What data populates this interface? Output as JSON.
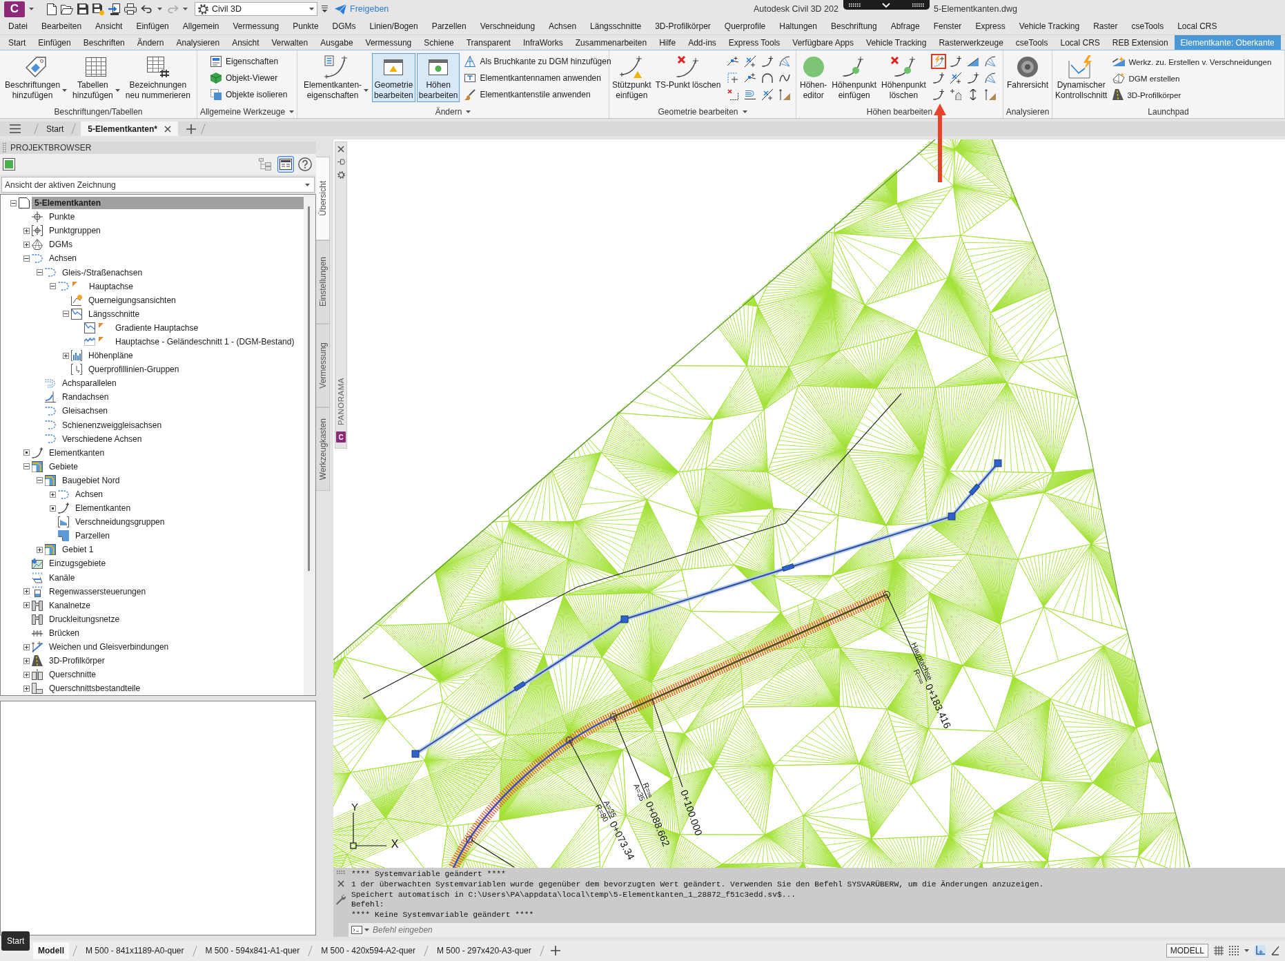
{
  "title_bar": {
    "logo": "C",
    "workspace": "Civil 3D",
    "share": "Freigeben",
    "title_left": "Autodesk Civil 3D 202",
    "title_right": "5-Elementkanten.dwg"
  },
  "menu": [
    "Datei",
    "Bearbeiten",
    "Ansicht",
    "Einfügen",
    "Allgemein",
    "Vermessung",
    "Punkte",
    "DGMs",
    "Linien/Bogen",
    "Parzellen",
    "Verschneidung",
    "Achsen",
    "Längsschnitte",
    "3D-Profilkörper",
    "Querprofile",
    "Haltungen",
    "Beschriftung",
    "Abfrage",
    "Fenster",
    "Express",
    "Vehicle Tracking",
    "Raster",
    "cseTools",
    "Local CRS"
  ],
  "ribbon_tabs": [
    {
      "label": "Start",
      "selected": false
    },
    {
      "label": "Einfügen",
      "selected": false
    },
    {
      "label": "Beschriften",
      "selected": false
    },
    {
      "label": "Ändern",
      "selected": false
    },
    {
      "label": "Analysieren",
      "selected": false
    },
    {
      "label": "Ansicht",
      "selected": false
    },
    {
      "label": "Verwalten",
      "selected": false
    },
    {
      "label": "Ausgabe",
      "selected": false
    },
    {
      "label": "Vermessung",
      "selected": false
    },
    {
      "label": "Schiene",
      "selected": false
    },
    {
      "label": "Transparent",
      "selected": false
    },
    {
      "label": "InfraWorks",
      "selected": false
    },
    {
      "label": "Zusammenarbeiten",
      "selected": false
    },
    {
      "label": "Hilfe",
      "selected": false
    },
    {
      "label": "Add-ins",
      "selected": false
    },
    {
      "label": "Express Tools",
      "selected": false
    },
    {
      "label": "Verfügbare Apps",
      "selected": false
    },
    {
      "label": "Vehicle Tracking",
      "selected": false
    },
    {
      "label": "Rasterwerkzeuge",
      "selected": false
    },
    {
      "label": "cseTools",
      "selected": false
    },
    {
      "label": "Local CRS",
      "selected": false
    },
    {
      "label": "REB Extension",
      "selected": false
    },
    {
      "label": "Elementkante: Oberkante",
      "selected": true
    }
  ],
  "panels": [
    {
      "title": "Beschriftungen/Tabellen",
      "menu": false,
      "large": [
        {
          "label": "Beschriftungen\nhinzufügen",
          "dropdown": true,
          "active": false
        },
        {
          "label": "Tabellen\nhinzufügen",
          "dropdown": true,
          "active": false
        },
        {
          "label": "Bezeichnungen\nneu nummerieren",
          "dropdown": false,
          "active": false
        }
      ]
    },
    {
      "title": "Allgemeine Werkzeuge",
      "menu": true,
      "small": [
        "Eigenschaften",
        "Objekt-Viewer",
        "Objekte isolieren"
      ]
    },
    {
      "title": "Ändern",
      "menu": true,
      "large": [
        {
          "label": "Elementkanten-\neigenschaften",
          "dropdown": true,
          "active": false
        },
        {
          "label": "Geometrie\nbearbeiten",
          "dropdown": false,
          "active": true
        },
        {
          "label": "Höhen\nbearbeiten",
          "dropdown": false,
          "active": true
        }
      ],
      "small": [
        "Als Bruchkante zu DGM hinzufügen",
        "Elementkantennamen anwenden",
        "Elementkantenstile anwenden"
      ]
    },
    {
      "title": "Geometrie bearbeiten",
      "menu": true,
      "large": [
        {
          "label": "Stützpunkt\neinfügen",
          "dropdown": false,
          "active": false
        },
        {
          "label": "TS-Punkt löschen",
          "dropdown": false,
          "active": false
        }
      ],
      "tools": [
        {
          "highlighted": false
        },
        {
          "highlighted": false
        },
        {
          "highlighted": false
        },
        {
          "highlighted": false
        },
        {
          "highlighted": false
        },
        {
          "highlighted": false
        },
        {
          "highlighted": false
        },
        {
          "highlighted": false
        },
        {
          "highlighted": false
        },
        {
          "highlighted": false
        },
        {
          "highlighted": false
        },
        {
          "highlighted": false
        }
      ]
    },
    {
      "title": "Höhen bearbeiten",
      "menu": false,
      "large": [
        {
          "label": "Höhen-\neditor",
          "dropdown": false,
          "active": false
        },
        {
          "label": "Höhenpunkt\neinfügen",
          "dropdown": false,
          "active": false
        },
        {
          "label": "Höhenpunkt\nlöschen",
          "dropdown": false,
          "active": false
        }
      ],
      "tools": [
        {
          "highlighted": true
        },
        {
          "highlighted": false
        },
        {
          "highlighted": false
        },
        {
          "highlighted": false
        },
        {
          "highlighted": false
        },
        {
          "highlighted": false
        },
        {
          "highlighted": false
        },
        {
          "highlighted": false
        },
        {
          "highlighted": false
        },
        {
          "highlighted": false
        },
        {
          "highlighted": false
        },
        {
          "highlighted": false
        }
      ]
    },
    {
      "title": "Analysieren",
      "menu": false,
      "large": [
        {
          "label": "Fahrersicht",
          "dropdown": false,
          "active": false
        }
      ]
    },
    {
      "title": "Launchpad",
      "menu": false,
      "large": [
        {
          "label": "Dynamischer\nKontrollschnitt",
          "dropdown": false,
          "active": false
        }
      ],
      "small": [
        "Werkz. zu. Erstellen v. Verschneidungen",
        "DGM erstellen",
        "3D-Profilkörper"
      ]
    }
  ],
  "doc_tabs": [
    {
      "label": "Start",
      "selected": false
    },
    {
      "label": "5-Elementkanten*",
      "selected": true
    }
  ],
  "browser": {
    "title": "PROJEKTBROWSER",
    "view_buttons": [
      {
        "selected": false
      },
      {
        "selected": true
      }
    ],
    "view": "Ansicht der aktiven Zeichnung",
    "tree": [
      {
        "label": "5-Elementkanten",
        "selected": true,
        "flag": false,
        "expanded": true,
        "partial": false,
        "children": [
          {
            "label": "Punkte",
            "selected": false,
            "flag": false
          },
          {
            "label": "Punktgruppen",
            "selected": false,
            "flag": false,
            "expanded": false,
            "partial": false
          },
          {
            "label": "DGMs",
            "selected": false,
            "flag": false,
            "expanded": false,
            "partial": false
          },
          {
            "label": "Achsen",
            "selected": false,
            "flag": false,
            "expanded": true,
            "partial": false,
            "children": [
              {
                "label": "Gleis-/Straßenachsen",
                "selected": false,
                "flag": false,
                "expanded": true,
                "partial": false,
                "children": [
                  {
                    "label": "Hauptachse",
                    "selected": false,
                    "flag": true,
                    "expanded": true,
                    "partial": false,
                    "children": [
                      {
                        "label": "Querneigungsansichten",
                        "selected": false,
                        "flag": false
                      },
                      {
                        "label": "Längsschnitte",
                        "selected": false,
                        "flag": false,
                        "expanded": true,
                        "partial": false,
                        "children": [
                          {
                            "label": "Gradiente Hauptachse",
                            "selected": false,
                            "flag": true
                          },
                          {
                            "label": "Hauptachse - Geländeschnitt 1 - (DGM-Bestand)",
                            "selected": false,
                            "flag": true
                          }
                        ]
                      },
                      {
                        "label": "Höhenpläne",
                        "selected": false,
                        "flag": false,
                        "expanded": false,
                        "partial": false
                      },
                      {
                        "label": "Querprofillinien-Gruppen",
                        "selected": false,
                        "flag": false
                      }
                    ]
                  }
                ]
              },
              {
                "label": "Achsparallelen",
                "selected": false,
                "flag": false
              },
              {
                "label": "Randachsen",
                "selected": false,
                "flag": false
              },
              {
                "label": "Gleisachsen",
                "selected": false,
                "flag": false
              },
              {
                "label": "Schienenzweiggleisachsen",
                "selected": false,
                "flag": false
              },
              {
                "label": "Verschiedene Achsen",
                "selected": false,
                "flag": false
              }
            ]
          },
          {
            "label": "Elementkanten",
            "selected": false,
            "flag": false,
            "expanded": false,
            "partial": true
          },
          {
            "label": "Gebiete",
            "selected": false,
            "flag": false,
            "expanded": true,
            "partial": false,
            "children": [
              {
                "label": "Baugebiet Nord",
                "selected": false,
                "flag": false,
                "expanded": true,
                "partial": false,
                "children": [
                  {
                    "label": "Achsen",
                    "selected": false,
                    "flag": false,
                    "expanded": false,
                    "partial": false
                  },
                  {
                    "label": "Elementkanten",
                    "selected": false,
                    "flag": false,
                    "expanded": false,
                    "partial": true
                  },
                  {
                    "label": "Verschneidungsgruppen",
                    "selected": false,
                    "flag": false
                  },
                  {
                    "label": "Parzellen",
                    "selected": false,
                    "flag": false
                  }
                ]
              },
              {
                "label": "Gebiet 1",
                "selected": false,
                "flag": false,
                "expanded": false,
                "partial": false
              }
            ]
          },
          {
            "label": "Einzugsgebiete",
            "selected": false,
            "flag": false
          },
          {
            "label": "Kanäle",
            "selected": false,
            "flag": false
          },
          {
            "label": "Regenwassersteuerungen",
            "selected": false,
            "flag": false,
            "expanded": false,
            "partial": false
          },
          {
            "label": "Kanalnetze",
            "selected": false,
            "flag": false,
            "expanded": false,
            "partial": false
          },
          {
            "label": "Druckleitungsnetze",
            "selected": false,
            "flag": false
          },
          {
            "label": "Brücken",
            "selected": false,
            "flag": false
          },
          {
            "label": "Weichen und Gleisverbindungen",
            "selected": false,
            "flag": false,
            "expanded": false,
            "partial": false
          },
          {
            "label": "3D-Profilkörper",
            "selected": false,
            "flag": false,
            "expanded": false,
            "partial": false
          },
          {
            "label": "Querschnitte",
            "selected": false,
            "flag": false,
            "expanded": false,
            "partial": false
          },
          {
            "label": "Querschnittsbestandteile",
            "selected": false,
            "flag": false,
            "expanded": false,
            "partial": false
          }
        ]
      }
    ],
    "side_tabs": [
      {
        "label": "Übersicht",
        "selected": true
      },
      {
        "label": "Einstellungen",
        "selected": false
      },
      {
        "label": "Vermessung",
        "selected": false
      },
      {
        "label": "Werkzeugkasten",
        "selected": false
      }
    ]
  },
  "panorama": {
    "label": "PANORAMA",
    "badge": "C"
  },
  "drawing": {
    "labels": [
      {
        "above": "Hauptachse",
        "below": "R=∞",
        "station": "0+183.416"
      },
      {
        "station": "0+100.000"
      },
      {
        "above": "R=∞",
        "below": "A=35",
        "station": "0+088.662"
      },
      {
        "above": "A=35",
        "below": "R=80",
        "station": "0+073.34"
      }
    ],
    "ucs": {
      "x": "X",
      "y": "Y"
    }
  },
  "command_line": {
    "history": [
      "**** Systemvariable geändert ****",
      "1 der überwachten Systemvariablen wurde gegenüber dem bevorzugten Wert geändert. Verwenden Sie den Befehl SYSVARÜBERW, um die Änderungen anzuzeigen.",
      "Speichert automatisch in C:\\Users\\PA\\appdata\\local\\temp\\5-Elementkanten_1_28872_f51c3edd.sv$...",
      "Befehl:",
      "**** Keine Systemvariable geändert ****"
    ],
    "placeholder": "Befehl eingeben"
  },
  "status_bar": {
    "tooltip": "Start",
    "layouts": [
      {
        "label": "Modell",
        "selected": true
      },
      {
        "label": "M 500 - 841x1189-A0-quer",
        "selected": false
      },
      {
        "label": "M 500 - 594x841-A1-quer",
        "selected": false
      },
      {
        "label": "M 500 - 420x594-A2-quer",
        "selected": false
      },
      {
        "label": "M 500 - 297x420-A3-quer",
        "selected": false
      }
    ],
    "space": "MODELL",
    "toggles": [
      {
        "on": false
      },
      {
        "on": false
      },
      {
        "on": true
      },
      {
        "on": false
      }
    ]
  }
}
